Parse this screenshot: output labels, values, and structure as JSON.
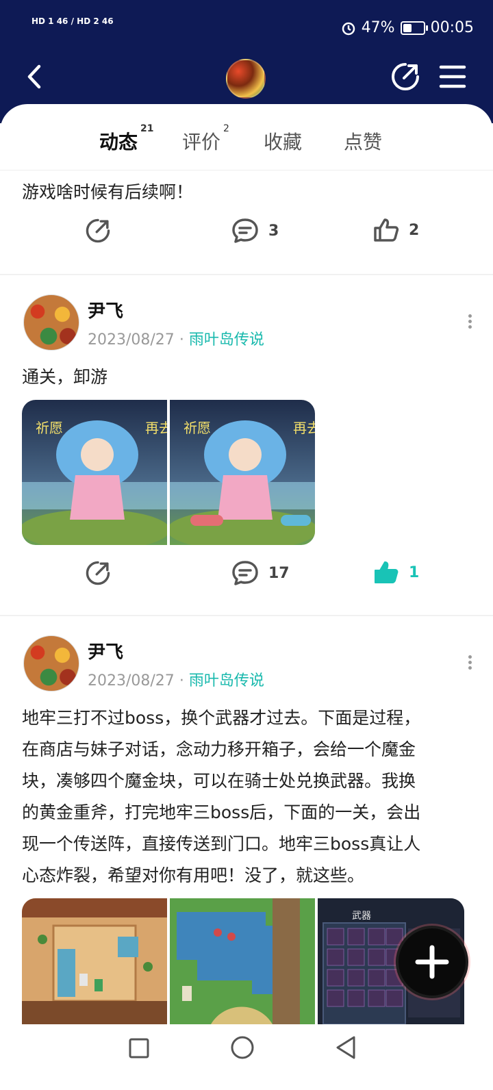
{
  "status_bar": {
    "signal_left": "HD 1 46 / HD 2 46",
    "battery": "47%",
    "time": "00:05"
  },
  "tabs": [
    {
      "label": "动态",
      "count": "21"
    },
    {
      "label": "评价",
      "count": "2"
    },
    {
      "label": "收藏",
      "count": ""
    },
    {
      "label": "点赞",
      "count": ""
    }
  ],
  "post0": {
    "text": "游戏啥时候有后续啊！",
    "comments": "3",
    "likes": "2"
  },
  "post1": {
    "author": "尹飞",
    "date": "2023/08/27",
    "dot": "·",
    "game": "雨叶岛传说",
    "text": "通关，卸游",
    "image_captions": [
      "祈愿",
      "再去",
      "祈愿",
      "再去"
    ],
    "comments": "17",
    "likes": "1"
  },
  "post2": {
    "author": "尹飞",
    "date": "2023/08/27",
    "dot": "·",
    "game": "雨叶岛传说",
    "text_lines": [
      "地牢三打不过boss，换个武器才过去。下面是过程，",
      "在商店与妹子对话，念动力移开箱子，会给一个魔金",
      "块，凑够四个魔金块，可以在骑士处兑换武器。我换",
      "的黄金重斧，打完地牢三boss后，下面的一关，会出",
      "现一个传送阵，直接传送到门口。地牢三boss真让人",
      "心态炸裂，希望对你有用吧！没了，就这些。"
    ],
    "inventory_title": "武器"
  },
  "colors": {
    "header": "#0e1a55",
    "accent": "#19c3b6",
    "liked": "#19c3b6"
  },
  "icons": [
    "back-icon",
    "share-icon",
    "menu-icon",
    "comment-icon",
    "like-icon",
    "more-icon",
    "plus-icon",
    "square-nav-icon",
    "circle-nav-icon",
    "triangle-nav-icon"
  ]
}
